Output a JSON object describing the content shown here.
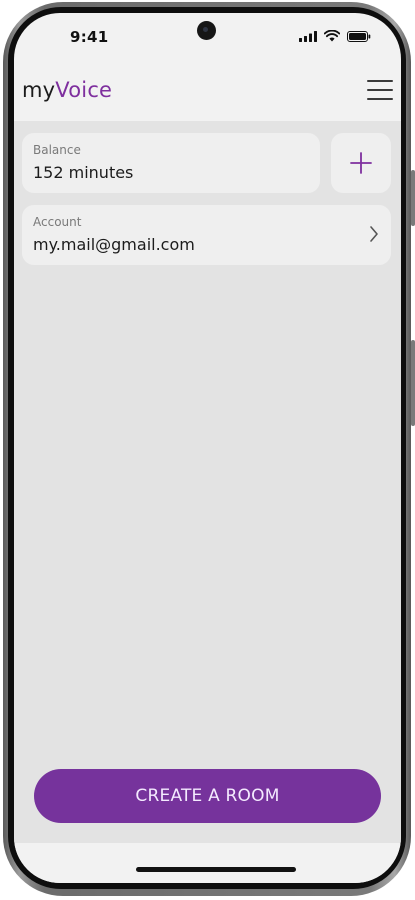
{
  "status_bar": {
    "time": "9:41"
  },
  "header": {
    "logo_prefix": "my",
    "logo_suffix": "Voice",
    "menu_icon": "hamburger-menu-icon"
  },
  "balance": {
    "label": "Balance",
    "value": "152 minutes"
  },
  "add_button": {
    "icon": "plus-icon"
  },
  "account": {
    "label": "Account",
    "value": "my.mail@gmail.com",
    "icon": "chevron-right-icon"
  },
  "actions": {
    "create_room_label": "CREATE A ROOM"
  },
  "colors": {
    "brand_purple": "#76339c",
    "logo_purple": "#7e2f9e",
    "background": "#e3e3e3",
    "card": "#efefef"
  }
}
